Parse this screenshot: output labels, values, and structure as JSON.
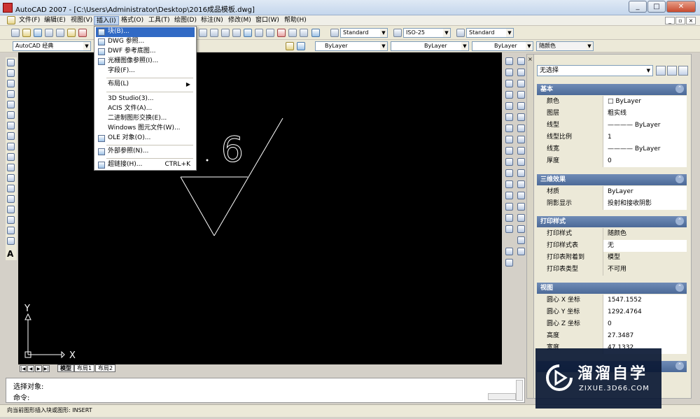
{
  "window": {
    "title": "AutoCAD 2007 - [C:\\Users\\Administrator\\Desktop\\2016成品模板.dwg]",
    "minimize": "_",
    "restore": "□",
    "close": "✕"
  },
  "menubar": {
    "items": [
      "文件(F)",
      "编辑(E)",
      "视图(V)",
      "插入(I)",
      "格式(O)",
      "工具(T)",
      "绘图(D)",
      "标注(N)",
      "修改(M)",
      "窗口(W)",
      "帮助(H)"
    ],
    "active_index": 3,
    "mdi_min": "_",
    "mdi_restore": "▫",
    "mdi_close": "×"
  },
  "toolbar": {
    "text_style": "Standard",
    "dim_style": "ISO-25",
    "table_style": "Standard",
    "workspace": "AutoCAD 经典",
    "layer_color": "ByLayer",
    "linetype": "ByLayer",
    "lineweight": "ByLayer",
    "plot_style": "随颜色"
  },
  "insert_menu": {
    "items": [
      {
        "label": "块(B)...",
        "icon": "block-icon",
        "highlight": true
      },
      {
        "label": "DWG 参照...",
        "icon": "dwg-ref-icon"
      },
      {
        "label": "DWF 参考底图...",
        "icon": "dwf-icon"
      },
      {
        "label": "光栅图像参照(I)...",
        "icon": "raster-icon"
      },
      {
        "label": "字段(F)..."
      },
      {
        "separator": true
      },
      {
        "label": "布局(L)",
        "submenu": true
      },
      {
        "separator": true
      },
      {
        "label": "3D Studio(3)..."
      },
      {
        "label": "ACIS 文件(A)..."
      },
      {
        "label": "二进制图形交换(E)..."
      },
      {
        "label": "Windows 图元文件(W)..."
      },
      {
        "label": "OLE 对象(O)...",
        "icon": "ole-icon"
      },
      {
        "separator": true
      },
      {
        "label": "外部参照(N)...",
        "icon": "xref-icon"
      },
      {
        "separator": true
      },
      {
        "label": "超链接(H)...",
        "shortcut": "CTRL+K",
        "icon": "hyperlink-icon"
      }
    ]
  },
  "drawing": {
    "text_value": "6",
    "ucs_x": "X",
    "ucs_y": "Y"
  },
  "layout_tabs": [
    "模型",
    "布局1",
    "布局2"
  ],
  "command": {
    "line1": "选择对象:",
    "line2": "命令:"
  },
  "status": {
    "text": "向当前图形插入块或图形:  INSERT"
  },
  "properties": {
    "selection": "无选择",
    "sections": [
      {
        "title": "基本",
        "rows": [
          {
            "name": "颜色",
            "value": "□ ByLayer"
          },
          {
            "name": "图层",
            "value": "粗实线"
          },
          {
            "name": "线型",
            "value": "———— ByLayer"
          },
          {
            "name": "线型比例",
            "value": "1"
          },
          {
            "name": "线宽",
            "value": "———— ByLayer"
          },
          {
            "name": "厚度",
            "value": "0"
          }
        ]
      },
      {
        "title": "三维效果",
        "rows": [
          {
            "name": "材质",
            "value": "ByLayer"
          },
          {
            "name": "阴影显示",
            "value": "投射和接收阴影"
          }
        ]
      },
      {
        "title": "打印样式",
        "rows": [
          {
            "name": "打印样式",
            "value": "随颜色"
          },
          {
            "name": "打印样式表",
            "value": "无"
          },
          {
            "name": "打印表附着到",
            "value": "模型"
          },
          {
            "name": "打印表类型",
            "value": "不可用"
          }
        ]
      },
      {
        "title": "视图",
        "rows": [
          {
            "name": "圆心 X 坐标",
            "value": "1547.1552"
          },
          {
            "name": "圆心 Y 坐标",
            "value": "1292.4764"
          },
          {
            "name": "圆心 Z 坐标",
            "value": "0"
          },
          {
            "name": "高度",
            "value": "27.3487"
          },
          {
            "name": "宽度",
            "value": "47.1332"
          }
        ]
      }
    ]
  },
  "watermark": {
    "title": "溜溜自学",
    "subtitle": "ZIXUE.3D66.COM"
  }
}
